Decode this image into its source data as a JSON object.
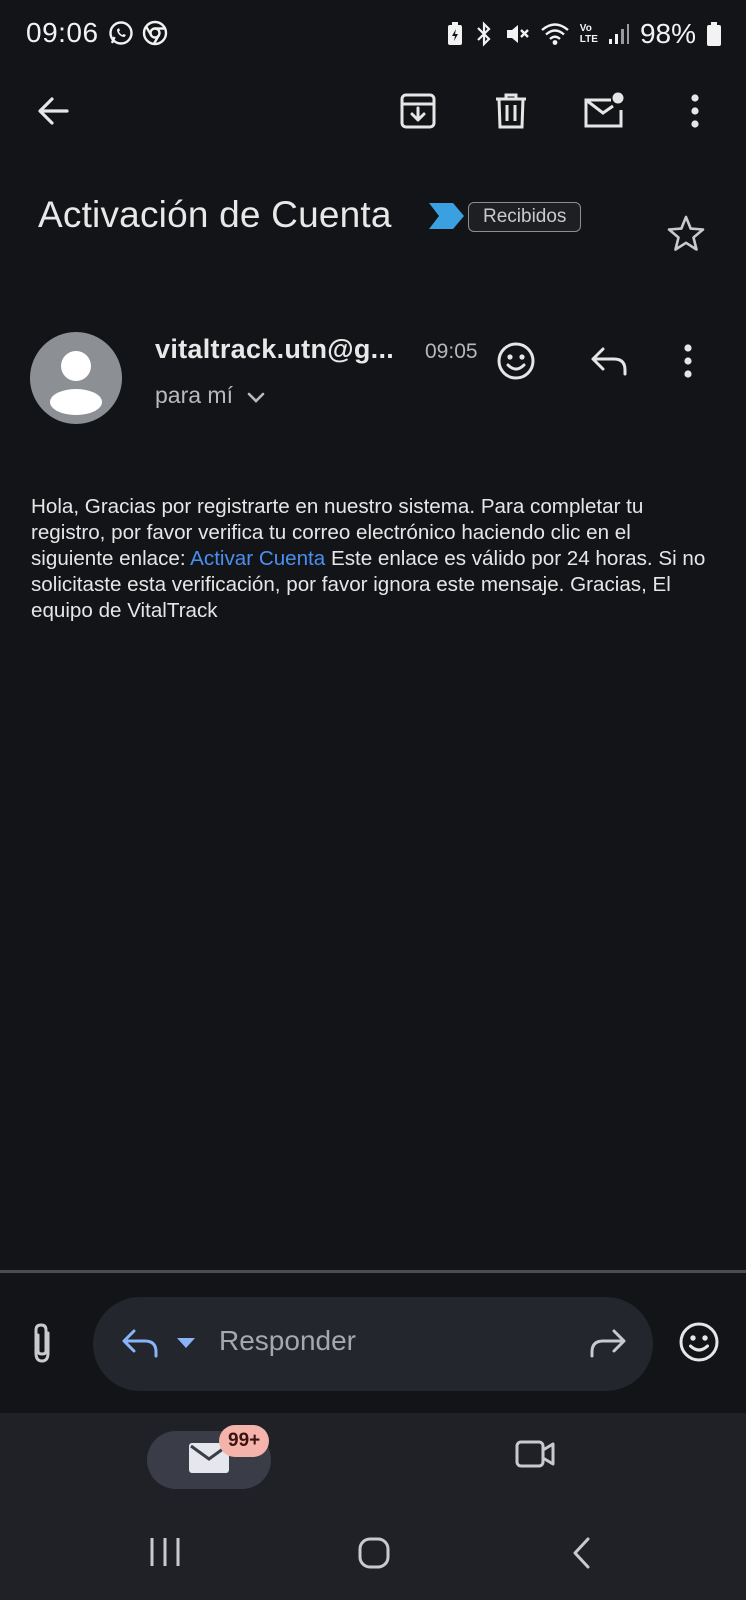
{
  "status_bar": {
    "time": "09:06",
    "battery_percent": "98%",
    "left_icons": [
      "whatsapp-icon",
      "chrome-icon"
    ],
    "right_icons": [
      "battery-saver-icon",
      "bluetooth-icon",
      "mute-icon",
      "wifi-icon",
      "volte-icon",
      "signal-icon",
      "battery-icon"
    ],
    "volte_label_top": "Vo",
    "volte_label_bottom": "LTE"
  },
  "toolbar": {
    "back_icon": "arrow-back-icon",
    "archive_icon": "archive-icon",
    "delete_icon": "delete-icon",
    "mark_unread_icon": "mark-unread-icon",
    "more_icon": "more-vertical-icon"
  },
  "email": {
    "subject": "Activación de Cuenta",
    "label": "Recibidos",
    "sender": "vitaltrack.utn@g...",
    "time": "09:05",
    "recipient": "para mí",
    "body_before_link": "Hola, Gracias por registrarte en nuestro sistema. Para completar tu registro, por favor verifica tu correo electrónico haciendo clic en el siguiente enlace: ",
    "link_text": "Activar Cuenta",
    "body_after_link": " Este enlace es válido por 24 horas. Si no solicitaste esta verificación, por favor ignora este mensaje. Gracias, El equipo de VitalTrack"
  },
  "reply_bar": {
    "placeholder": "Responder"
  },
  "bottom_nav": {
    "mail_badge": "99+"
  },
  "colors": {
    "background": "#131417",
    "link": "#4a8ff0",
    "importance_marker": "#3aa0e0",
    "badge": "#f4b3ab"
  }
}
